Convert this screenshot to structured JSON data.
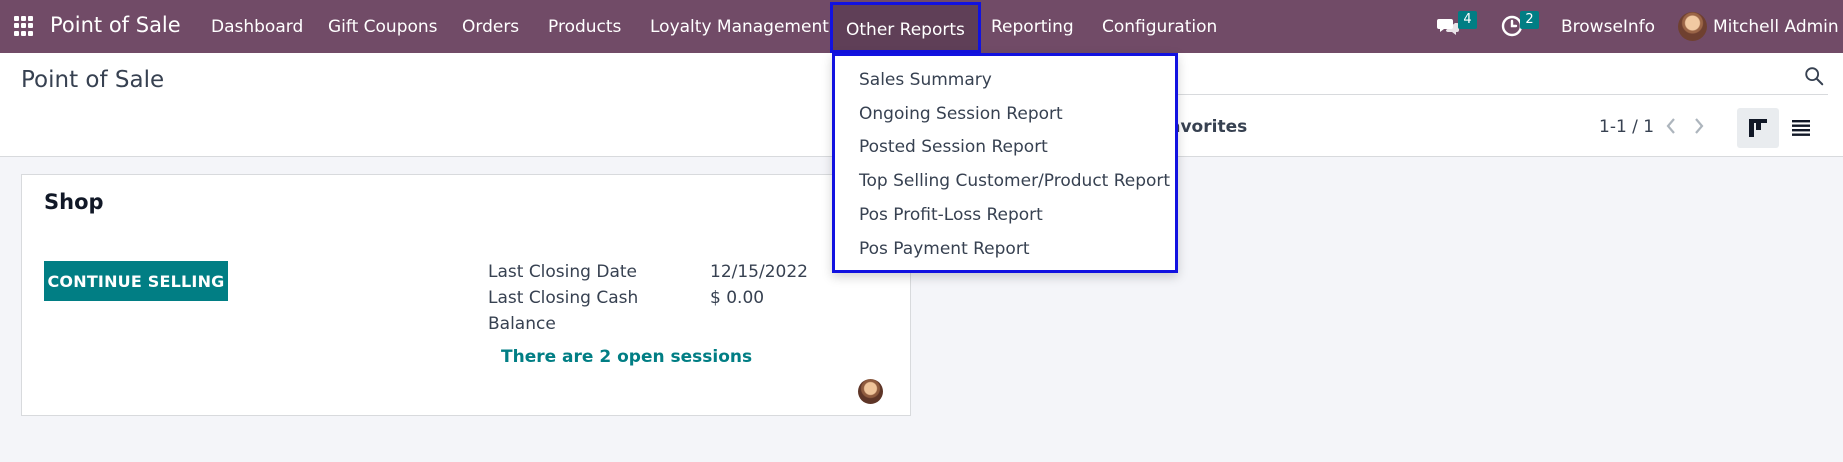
{
  "navbar": {
    "brand": "Point of Sale",
    "menu": [
      "Dashboard",
      "Gift Coupons",
      "Orders",
      "Products",
      "Loyalty Management",
      "Other Reports",
      "Reporting",
      "Configuration"
    ],
    "messages_count": "4",
    "activities_count": "2",
    "company": "BrowseInfo",
    "user": "Mitchell Admin",
    "colors": {
      "bar": "#714b67",
      "badge": "#017e84",
      "highlight": "#1212e0"
    }
  },
  "control_panel": {
    "title": "Point of Sale",
    "favorites_label": "avorites",
    "pager": "1-1 / 1"
  },
  "dropdown": {
    "items": [
      "Sales Summary",
      "Ongoing Session Report",
      "Posted Session Report",
      "Top Selling Customer/Product Report",
      "Pos Profit-Loss Report",
      "Pos Payment Report"
    ]
  },
  "card": {
    "title": "Shop",
    "button": "CONTINUE SELLING",
    "stats": [
      {
        "label": "Last Closing Date",
        "value": "12/15/2022"
      },
      {
        "label": "Last Closing Cash",
        "value": "$ 0.00"
      },
      {
        "label": "Balance",
        "value": ""
      }
    ],
    "sessions_link": "There are 2 open sessions"
  }
}
